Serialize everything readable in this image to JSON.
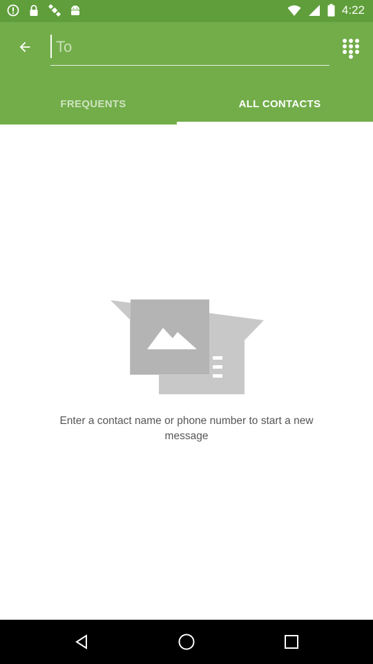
{
  "status_bar": {
    "time": "4:22",
    "icons_left": [
      "alert-circle-icon",
      "lock-icon",
      "satellite-icon",
      "android-icon"
    ],
    "icons_right": [
      "wifi-icon",
      "signal-icon",
      "battery-icon"
    ]
  },
  "header": {
    "to_placeholder": "To",
    "to_value": "",
    "accent_color": "#72ad4a",
    "status_color": "#5f9e3a"
  },
  "tabs": [
    {
      "label": "FREQUENTS",
      "selected": false
    },
    {
      "label": "ALL CONTACTS",
      "selected": true
    }
  ],
  "empty_state": {
    "message": "Enter a contact name or phone number to start a new message",
    "icon": "contact-card-placeholder-icon"
  },
  "nav_bar": {
    "buttons": [
      "back-icon",
      "home-icon",
      "recents-icon"
    ]
  }
}
